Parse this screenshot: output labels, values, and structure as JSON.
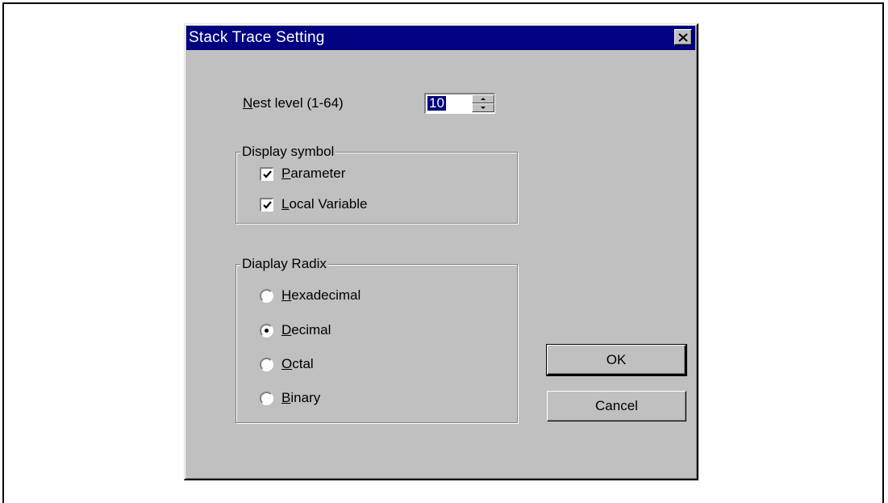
{
  "dialog": {
    "title": "Stack Trace Setting",
    "close_icon": "close-x-icon"
  },
  "nest_level": {
    "label_mnemonic": "N",
    "label_rest": "est level (1-64)",
    "value": "10",
    "spinner_icon": "spin-up-down-icon"
  },
  "display_symbol": {
    "legend": "Display symbol",
    "items": [
      {
        "mnemonic": "P",
        "rest": "arameter",
        "checked": true
      },
      {
        "mnemonic": "L",
        "rest": "ocal Variable",
        "checked": true
      }
    ]
  },
  "display_radix": {
    "legend": "Diaplay Radix",
    "options": [
      {
        "mnemonic": "H",
        "rest": "exadecimal",
        "selected": false
      },
      {
        "mnemonic": "D",
        "rest": "ecimal",
        "selected": true
      },
      {
        "mnemonic": "O",
        "rest": "ctal",
        "selected": false
      },
      {
        "mnemonic": "B",
        "rest": "inary",
        "selected": false
      }
    ]
  },
  "buttons": {
    "ok_label": "OK",
    "cancel_label": "Cancel"
  },
  "colors": {
    "titlebar": "#000080",
    "face": "#c0c0c0"
  }
}
